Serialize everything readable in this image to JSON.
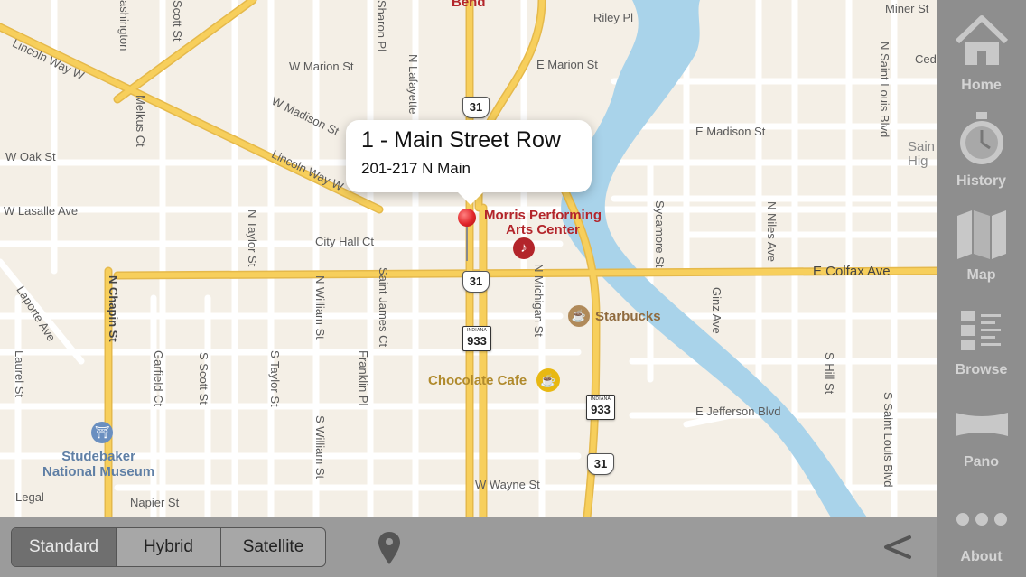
{
  "callout": {
    "title": "1 - Main Street Row",
    "subtitle": "201-217 N Main"
  },
  "map": {
    "streets": {
      "lincoln_way_w_1": "Lincoln Way W",
      "lincoln_way_w_2": "Lincoln Way W",
      "w_marion": "W Marion St",
      "e_marion": "E Marion St",
      "w_madison": "W Madison St",
      "e_madison": "E Madison St",
      "w_oak": "W Oak St",
      "w_lasalle": "W Lasalle Ave",
      "city_hall": "City Hall Ct",
      "e_colfax": "E Colfax Ave",
      "riley": "Riley Pl",
      "miner": "Miner St",
      "cedar": "Ced",
      "e_jefferson": "E Jefferson Blvd",
      "w_wayne": "W Wayne St",
      "napier": "Napier St",
      "n_chapin": "N Chapin St",
      "melkus": "Melkus Ct",
      "n_taylor": "N Taylor St",
      "n_william": "N William St",
      "saint_james": "Saint James Ct",
      "n_michigan": "N Michigan St",
      "sycamore": "Sycamore St",
      "n_niles": "N Niles Ave",
      "ginz": "Ginz Ave",
      "s_hill": "S Hill St",
      "n_saint_louis": "N Saint Louis Blvd",
      "s_saint_louis": "S Saint Louis Blvd",
      "laporte": "Laporte Ave",
      "laurel": "Laurel St",
      "garfield": "Garfield Ct",
      "s_scott": "S Scott St",
      "s_taylor": "S Taylor St",
      "s_william": "S William St",
      "franklin": "Franklin Pl",
      "scott_top": "Scott St",
      "sharon": "Sharon Pl",
      "n_lafayette": "N Lafayette",
      "top_left": "ashington",
      "saint_high": "Sain\nHig",
      "bend": "Bend"
    },
    "pois": {
      "morris": "Morris Performing\nArts Center",
      "starbucks": "Starbucks",
      "chocolate": "Chocolate Cafe",
      "studebaker": "Studebaker\nNational Museum"
    },
    "shields": {
      "us31_a": "31",
      "us31_b": "31",
      "us31_c": "31",
      "in933_a": "933",
      "in933_b": "933",
      "indiana": "INDIANA"
    },
    "legal": "Legal"
  },
  "bottombar": {
    "segments": [
      {
        "label": "Standard",
        "selected": true
      },
      {
        "label": "Hybrid",
        "selected": false
      },
      {
        "label": "Satellite",
        "selected": false
      }
    ],
    "location_icon": "location-pin-icon",
    "back_icon": "back-chevron-icon"
  },
  "sidebar": {
    "items": [
      {
        "label": "Home",
        "icon": "home-icon"
      },
      {
        "label": "History",
        "icon": "stopwatch-icon"
      },
      {
        "label": "Map",
        "icon": "folded-map-icon"
      },
      {
        "label": "Browse",
        "icon": "list-icon"
      },
      {
        "label": "Pano",
        "icon": "panorama-icon"
      },
      {
        "label": "About",
        "icon": "more-dots-icon"
      }
    ]
  },
  "colors": {
    "map_bg": "#f4efe6",
    "water": "#a9d3ea",
    "road_major": "#f7cf5c",
    "sidebar": "#8e8e8e",
    "bottombar": "#9b9b9b",
    "pin": "#e0262a",
    "poi_red": "#b3252b",
    "poi_gold": "#b08a2c"
  }
}
